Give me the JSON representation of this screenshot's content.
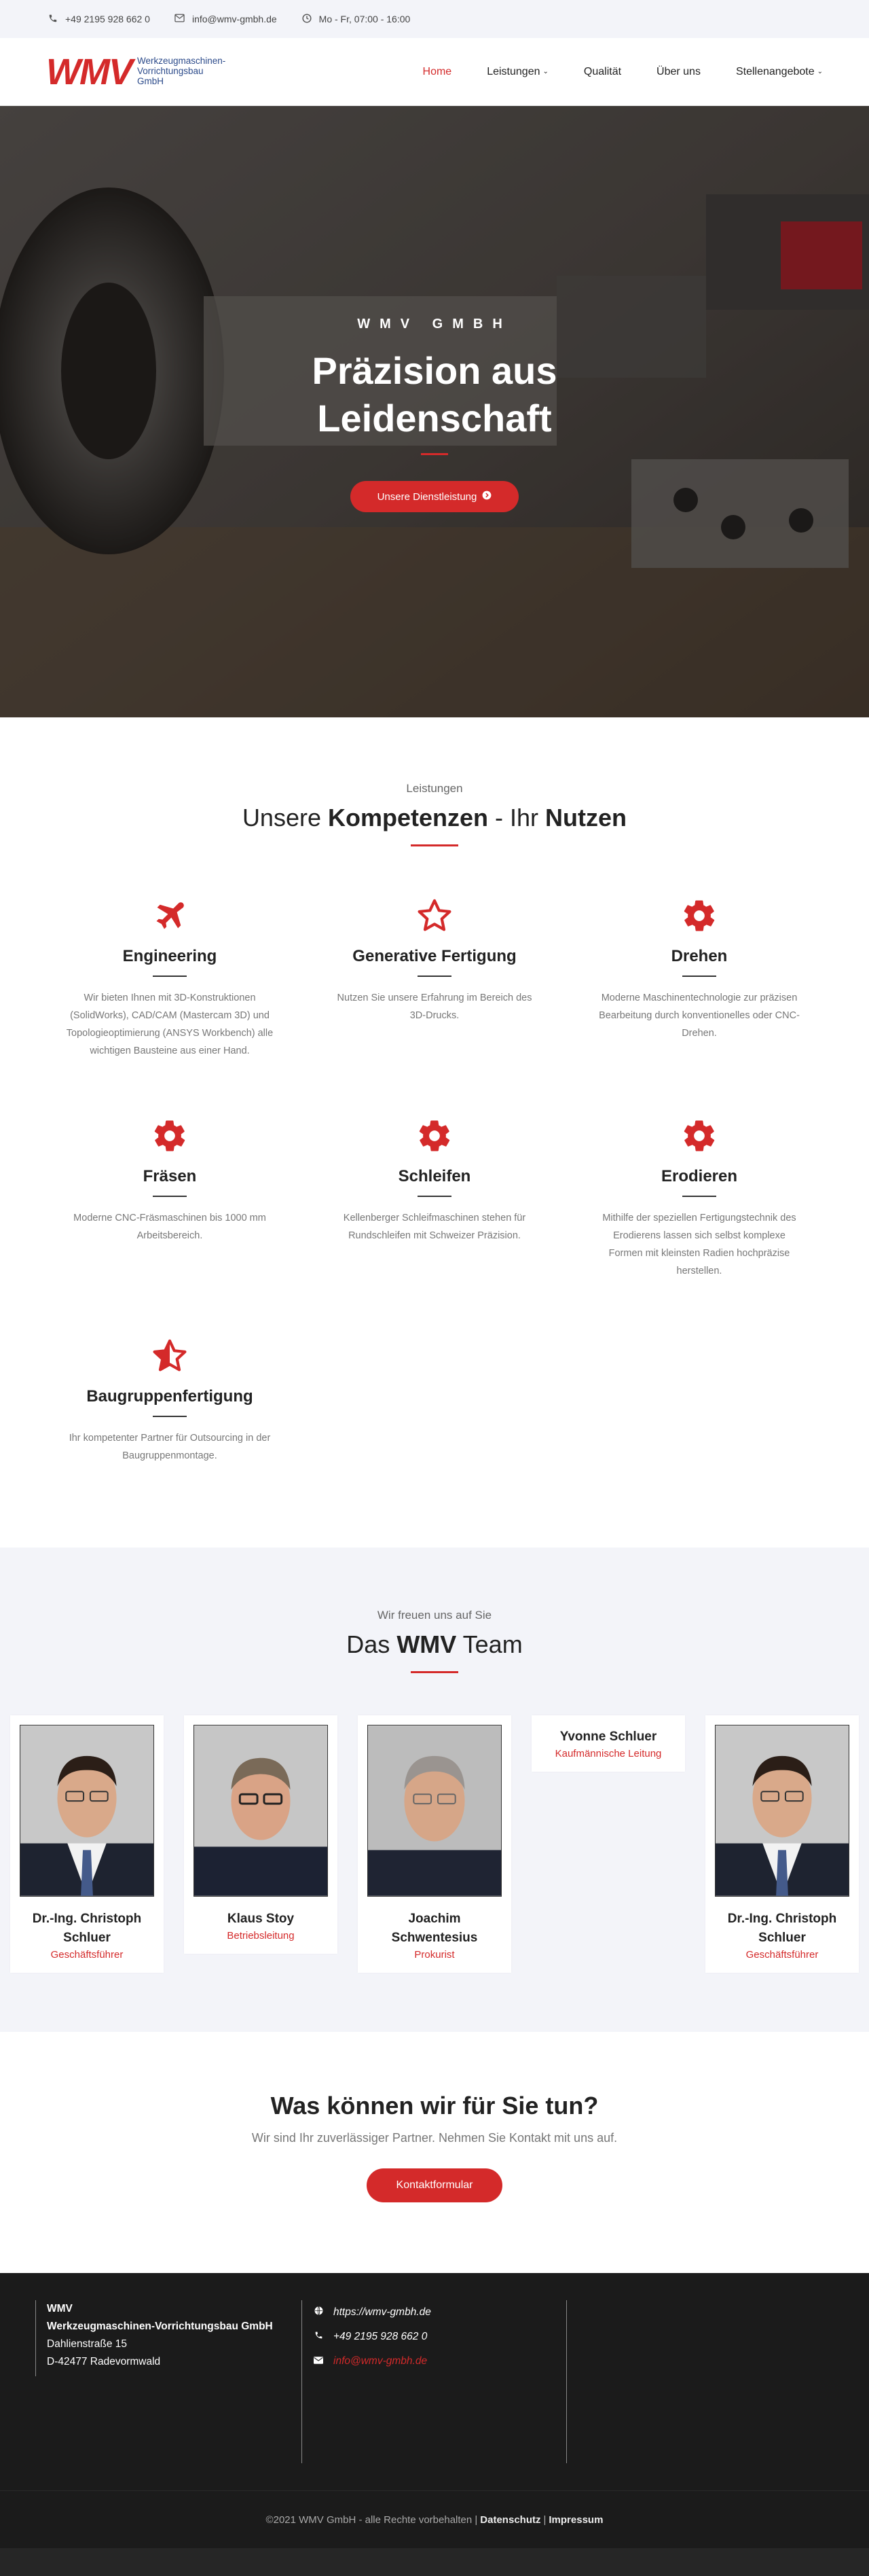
{
  "topbar": {
    "phone": "+49 2195 928 662 0",
    "email": "info@wmv-gmbh.de",
    "hours": "Mo - Fr, 07:00 - 16:00"
  },
  "header": {
    "logo_mark": "WMV",
    "logo_sub": "Werkzeugmaschinen-Vorrichtungsbau GmbH",
    "nav": [
      {
        "label": "Home",
        "active": true
      },
      {
        "label": "Leistungen",
        "dropdown": true
      },
      {
        "label": "Qualität"
      },
      {
        "label": "Über uns"
      },
      {
        "label": "Stellenangebote",
        "dropdown": true
      }
    ]
  },
  "hero": {
    "kicker": "WMV GMBH",
    "title_line1": "Präzision aus",
    "title_line2": "Leidenschaft",
    "button": "Unsere Dienstleistung"
  },
  "services": {
    "kicker": "Leistungen",
    "title_a": "Unsere ",
    "title_b": "Kompetenzen",
    "title_c": " - Ihr ",
    "title_d": "Nutzen",
    "items": [
      {
        "icon": "plane-icon",
        "title": "Engineering",
        "text": "Wir bieten Ihnen mit 3D-Konstruktionen (SolidWorks), CAD/CAM (Mastercam 3D) und Topologieoptimierung (ANSYS Workbench) alle wichtigen Bausteine aus einer Hand."
      },
      {
        "icon": "star-outline-icon",
        "title": "Generative Fertigung",
        "text": "Nutzen Sie unsere Erfahrung im Bereich des 3D-Drucks."
      },
      {
        "icon": "gear-icon",
        "title": "Drehen",
        "text": "Moderne Maschinentechnologie zur präzisen Bearbeitung durch konventionelles oder CNC-Drehen."
      },
      {
        "icon": "gear-icon",
        "title": "Fräsen",
        "text": "Moderne CNC-Fräsmaschinen bis 1000 mm Arbeitsbereich."
      },
      {
        "icon": "gear-icon",
        "title": "Schleifen",
        "text": "Kellenberger Schleifmaschinen stehen für Rundschleifen mit Schweizer Präzision."
      },
      {
        "icon": "gear-icon",
        "title": "Erodieren",
        "text": "Mithilfe der speziellen Fertigungstechnik des Erodierens lassen sich selbst komplexe Formen mit kleinsten Radien hochpräzise herstellen."
      },
      {
        "icon": "star-half-icon",
        "title": "Baugruppenfertigung",
        "text": "Ihr kompetenter Partner für Outsourcing in der Baugruppenmontage."
      }
    ]
  },
  "team": {
    "kicker": "Wir freuen uns auf Sie",
    "title_a": "Das ",
    "title_b": "WMV",
    "title_c": " Team",
    "members": [
      {
        "name": "Dr.-Ing. Christoph Schluer",
        "role": "Geschäftsführer",
        "photo": true
      },
      {
        "name": "Klaus Stoy",
        "role": "Betriebsleitung",
        "photo": true
      },
      {
        "name": "Joachim Schwentesius",
        "role": "Prokurist",
        "photo": true
      },
      {
        "name": "Yvonne Schluer",
        "role": "Kaufmännische Leitung",
        "photo": false
      },
      {
        "name": "Dr.-Ing. Christoph Schluer",
        "role": "Geschäftsführer",
        "photo": true
      }
    ]
  },
  "cta": {
    "title": "Was können wir für Sie tun?",
    "text": "Wir sind Ihr zuverlässiger Partner. Nehmen Sie Kontakt mit uns auf.",
    "button": "Kontaktformular"
  },
  "footer": {
    "company1": "WMV",
    "company2": "Werkzeugmaschinen-Vorrichtungsbau GmbH",
    "street": "Dahlienstraße 15",
    "city": "D-42477 Radevormwald",
    "web": "https://wmv-gmbh.de",
    "phone": "+49 2195 928 662 0",
    "email": "info@wmv-gmbh.de"
  },
  "copyright": {
    "text": "©2021 WMV GmbH - alle Rechte vorbehalten |",
    "privacy": "Datenschutz",
    "sep": "|",
    "imprint": "Impressum"
  },
  "colors": {
    "accent": "#d42a2a",
    "topbar_bg": "#f3f4f9",
    "footer_bg": "#1b1b1b"
  }
}
